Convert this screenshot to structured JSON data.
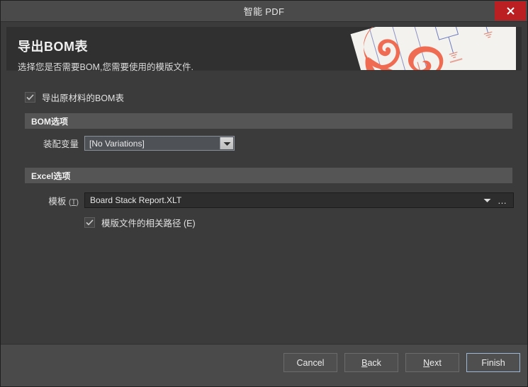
{
  "window": {
    "title": "智能 PDF",
    "close_icon": "close-icon"
  },
  "banner": {
    "title": "导出BOM表",
    "subtitle": "选择您是否需要BOM,您需要使用的模版文件.",
    "artwork": "acrobat-ribbon-over-schematic"
  },
  "options": {
    "export_bom": {
      "label": "导出原材料的BOM表",
      "checked": true
    }
  },
  "sections": [
    {
      "id": "bom",
      "header": "BOM选项"
    },
    {
      "id": "excel",
      "header": "Excel选项"
    }
  ],
  "bom_options": {
    "variant_label": "装配变量",
    "variant_value": "[No Variations]",
    "variant_options": [
      "[No Variations]"
    ],
    "dropdown_icon": "chevron-down-icon"
  },
  "excel_options": {
    "template_label": "模板",
    "template_mnemonic": "T",
    "template_value": "Board Stack Report.XLT",
    "dropdown_icon": "chevron-down-icon",
    "browse_label": "…",
    "relative_path": {
      "label": "模版文件的相关路径",
      "mnemonic": "E",
      "checked": true
    }
  },
  "footer": {
    "buttons": [
      {
        "name": "cancel",
        "label": "Cancel",
        "mnemonic": "",
        "focused": false
      },
      {
        "name": "back",
        "label": "ack",
        "mnemonic": "B",
        "focused": false
      },
      {
        "name": "next",
        "label": "ext",
        "mnemonic": "N",
        "focused": false
      },
      {
        "name": "finish",
        "label": "Finish",
        "mnemonic": "",
        "focused": true
      }
    ]
  },
  "colors": {
    "window_bg": "#3b3b3b",
    "titlebar_bg": "#4a4a4a",
    "close_red": "#bb1f22",
    "section_header_bg": "#555555",
    "banner_bg": "#303030",
    "accent_focus": "#9cb6d6",
    "acrobat_red": "#ef6c52"
  }
}
